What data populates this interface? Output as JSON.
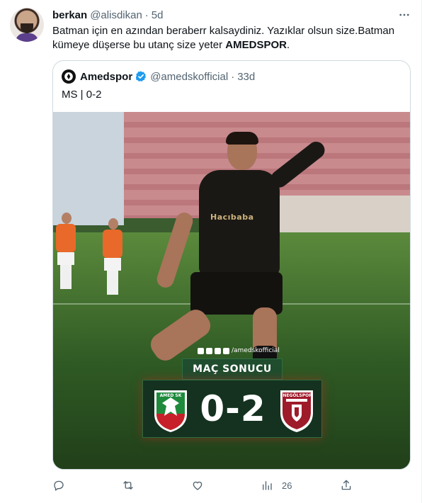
{
  "tweet": {
    "author_name": "berkan",
    "author_handle": "@alisdikan",
    "separator": "·",
    "time": "5d",
    "text_part1": "Batman için en azından beraberr kalsaydiniz. Yazıklar olsun size.Batman kümeye düşerse bu utanç size yeter ",
    "text_bold": "AMEDSPOR",
    "text_part2": "."
  },
  "quote": {
    "author_name": "Amedspor",
    "author_handle": "@amedskofficial",
    "separator": "·",
    "time": "33d",
    "text": "MS | 0-2"
  },
  "media": {
    "socials_handle": "/amedskofficial",
    "banner_title": "MAÇ SONUCU",
    "score": "0-2",
    "home_crest_label": "AMED SK",
    "away_crest_label": "İNEGÖLSPOR",
    "jersey_sponsor": "Hacıbaba",
    "colors": {
      "home_green": "#1f8a3c",
      "home_red": "#c8202a",
      "away_red": "#9e1b2a",
      "banner_bg": "#14321f"
    }
  },
  "actions": {
    "reply_icon": "reply-icon",
    "retweet_icon": "retweet-icon",
    "like_icon": "like-icon",
    "views_icon": "views-icon",
    "views_count": "26",
    "share_icon": "share-icon"
  },
  "icons": {
    "more": "more-icon",
    "verified": "verified-badge-icon"
  }
}
